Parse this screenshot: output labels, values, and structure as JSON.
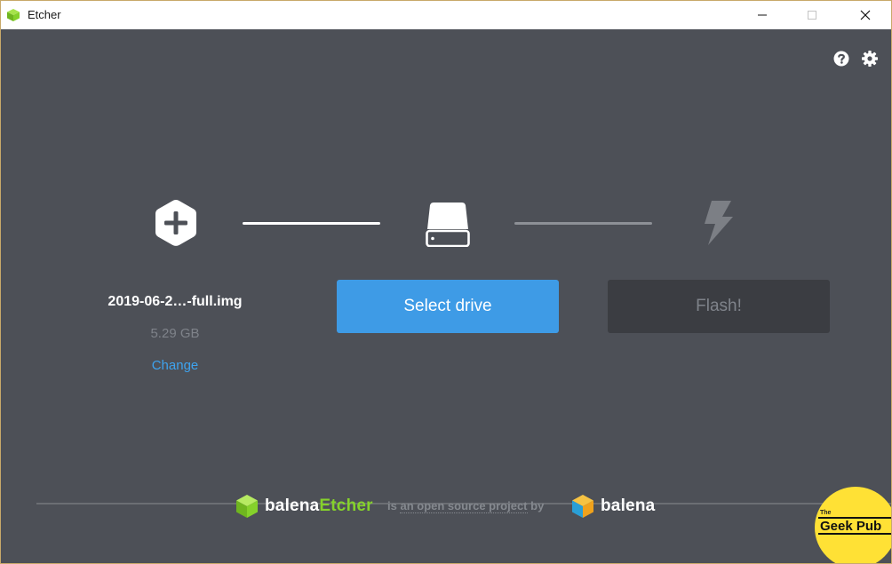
{
  "window": {
    "title": "Etcher",
    "icons": {
      "app": "etcher-cube-icon",
      "minimize": "minimize-icon",
      "maximize": "maximize-icon",
      "close": "close-icon"
    }
  },
  "toolbar": {
    "help_icon": "help-icon",
    "settings_icon": "gear-icon"
  },
  "steps": {
    "image": {
      "icon": "plus-hexagon-icon",
      "filename": "2019-06-2…-full.img",
      "size": "5.29 GB",
      "change_label": "Change"
    },
    "drive": {
      "icon": "drive-icon",
      "button_label": "Select drive"
    },
    "flash": {
      "icon": "lightning-icon",
      "button_label": "Flash!",
      "enabled": false
    }
  },
  "footer": {
    "brand_prefix": "balena",
    "brand_suffix": "Etcher",
    "text_is": "is",
    "text_link": "an open source project",
    "text_by": "by",
    "company": "balena"
  },
  "watermark": {
    "small": "The",
    "text": "Geek Pub"
  },
  "colors": {
    "background": "#4d5057",
    "accent_blue": "#3e9be6",
    "link_blue": "#3ea3ee",
    "etcher_green": "#85d12b",
    "disabled_button": "#3b3d42"
  }
}
